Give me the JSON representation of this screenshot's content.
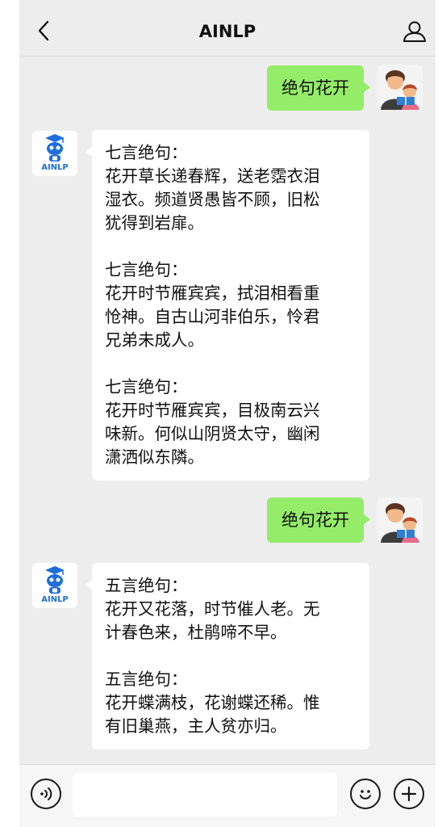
{
  "header": {
    "title": "AINLP",
    "back_icon": "chevron-left-icon",
    "profile_icon": "user-icon"
  },
  "colors": {
    "background": "#ededed",
    "my_bubble": "#95ec69",
    "bot_bubble": "#ffffff",
    "bot_brand": "#1e6fd9"
  },
  "bot": {
    "avatar_label": "AINLP"
  },
  "messages": [
    {
      "from": "me",
      "text": "绝句花开"
    },
    {
      "from": "bot",
      "text": "七言绝句：\n花开草长递春辉，送老霑衣泪\n湿衣。频道贤愚皆不顾，旧松\n犹得到岩扉。\n\n七言绝句：\n花开时节雁宾宾，拭泪相看重\n怆神。自古山河非伯乐，怜君\n兄弟未成人。\n\n七言绝句：\n花开时节雁宾宾，目极南云兴\n味新。何似山阴贤太守，幽闲\n潇洒似东隣。"
    },
    {
      "from": "me",
      "text": "绝句花开"
    },
    {
      "from": "bot",
      "text": "五言绝句：\n花开又花落，时节催人老。无\n计春色来，杜鹃啼不早。\n\n五言绝句：\n花开蝶满枝，花谢蝶还稀。惟\n有旧巢燕，主人贫亦归。"
    }
  ],
  "input_bar": {
    "voice_icon": "voice-icon",
    "emoji_icon": "emoji-icon",
    "plus_icon": "plus-icon",
    "value": ""
  }
}
